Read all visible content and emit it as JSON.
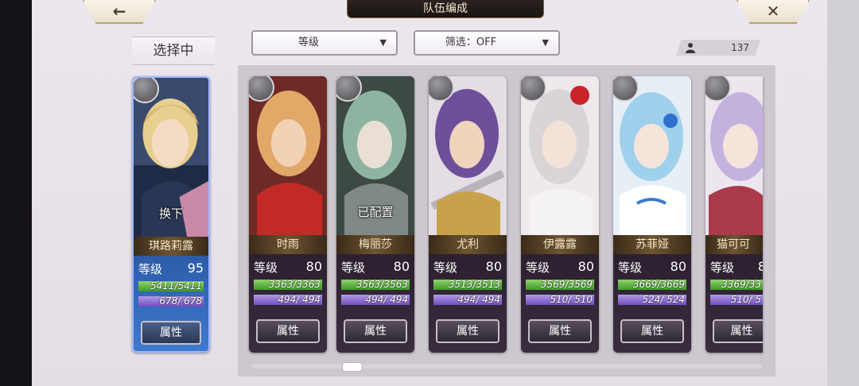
{
  "header": {
    "title": "队伍编成",
    "back_glyph": "←",
    "close_glyph": "✕"
  },
  "selecting_label": "选择中",
  "sort_dropdown": {
    "label": "等级",
    "arrow": "▼"
  },
  "filter_dropdown": {
    "label": "筛选：OFF",
    "arrow": "▼"
  },
  "unit_count": "137",
  "level_label": "等级",
  "attr_label": "属性",
  "selected": {
    "name": "琪路莉露",
    "level": "95",
    "hp": "5411/5411",
    "mp": "678/ 678",
    "overlay": "换下",
    "weapon_icon": "sword-icon"
  },
  "characters": [
    {
      "name": "时雨",
      "level": "80",
      "hp": "3363/3363",
      "mp": "494/ 494",
      "overlay": "",
      "weapon_icon": "sword-icon"
    },
    {
      "name": "梅丽莎",
      "level": "80",
      "hp": "3563/3563",
      "mp": "494/ 494",
      "overlay": "已配置",
      "weapon_icon": "sword-icon"
    },
    {
      "name": "尤利",
      "level": "80",
      "hp": "3513/3513",
      "mp": "494/ 494",
      "overlay": "",
      "weapon_icon": "sword-icon"
    },
    {
      "name": "伊露露",
      "level": "80",
      "hp": "3569/3569",
      "mp": "510/ 510",
      "overlay": "",
      "weapon_icon": "axe-icon"
    },
    {
      "name": "苏菲娅",
      "level": "80",
      "hp": "3669/3669",
      "mp": "524/ 524",
      "overlay": "",
      "weapon_icon": "axe-icon"
    },
    {
      "name": "猫可可",
      "level": "8",
      "hp": "3369/33",
      "mp": "510/ 5",
      "overlay": "",
      "weapon_icon": "axe-icon"
    }
  ],
  "colors": {
    "selected_card": "#3f7ad0",
    "hp_bar": "#5fb53f",
    "mp_bar": "#8f6fd8",
    "name_plate": "#6d5432"
  }
}
